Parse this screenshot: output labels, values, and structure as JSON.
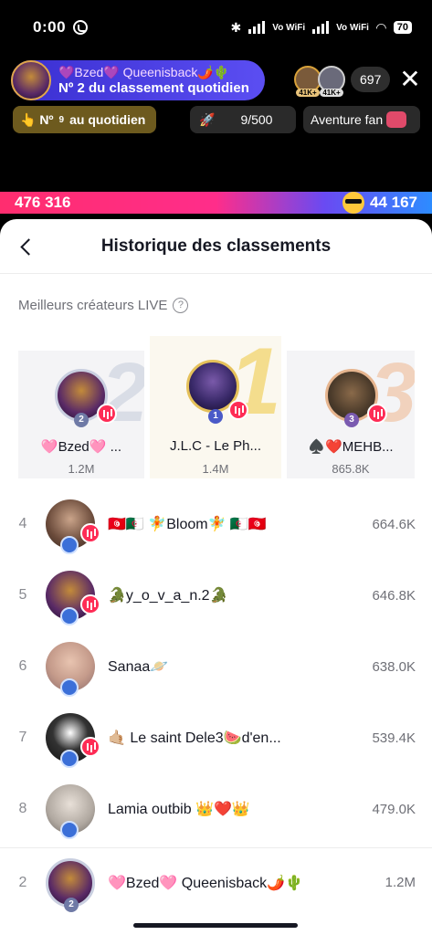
{
  "status_bar": {
    "time": "0:00",
    "vowifi_1": "Vo WiFi",
    "vowifi_2": "Vo WiFi",
    "battery": "70"
  },
  "live": {
    "host_name": "💜Bzed💜 Queenisback🌶️🌵",
    "daily_rank": "Nº 2 du classement quotidien",
    "viewer_badge_1": "41K+",
    "viewer_badge_2": "41K+",
    "viewer_count": "697",
    "daily_pill_prefix": "👆 Nº",
    "daily_pill_num": "9",
    "daily_pill_suffix": "au quotidien",
    "rocket_progress": "9/500",
    "adventure_label": "Aventure fan",
    "score_left": "476 316",
    "score_right": "44 167"
  },
  "sheet": {
    "title": "Historique des classements",
    "section_label": "Meilleurs créateurs LIVE",
    "podium": [
      {
        "place": "2",
        "rank_badge": "2",
        "name": "🩷Bzed🩷 ...",
        "score": "1.2M"
      },
      {
        "place": "1",
        "rank_badge": "1",
        "name": "J.L.C - Le Ph...",
        "score": "1.4M"
      },
      {
        "place": "3",
        "rank_badge": "3",
        "name": "♠️❤️MEHB...",
        "score": "865.8K"
      }
    ],
    "rows": [
      {
        "rank": "4",
        "name": "🇹🇳🇩🇿 🧚Bloom🧚 🇩🇿🇹🇳",
        "score": "664.6K"
      },
      {
        "rank": "5",
        "name": "🐊y_o_v_a_n.2🐊",
        "score": "646.8K"
      },
      {
        "rank": "6",
        "name": "Sanaa🪐",
        "score": "638.0K"
      },
      {
        "rank": "7",
        "name": "🤙🏼 Le saint Dele3🍉d'en...",
        "score": "539.4K"
      },
      {
        "rank": "8",
        "name": "Lamia outbib 👑❤️👑",
        "score": "479.0K"
      }
    ],
    "my_row": {
      "rank": "2",
      "rank_badge": "2",
      "name": "🩷Bzed🩷 Queenisback🌶️🌵",
      "score": "1.2M"
    }
  },
  "colors": {
    "accent_live": "#fe2c55",
    "pill_blue": "#3a2fd1",
    "gold": "#f4dd8d"
  }
}
